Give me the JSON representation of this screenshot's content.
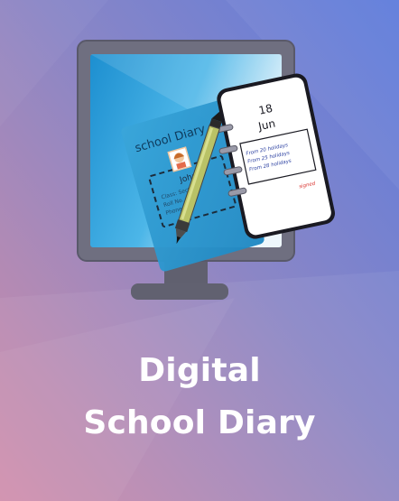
{
  "title": {
    "line1": "Digital",
    "line2": "School Diary"
  },
  "illustration": {
    "diary_cover_title": "school Diary",
    "student_name": "Johny",
    "id_card_lines": [
      "Class: Section",
      "Roll No.",
      "Phone No."
    ],
    "notebook_day": "18",
    "notebook_month": "Jun",
    "notebook_entries": [
      "From 20 holidays",
      "From 25 holidays",
      "From 28 holidays"
    ],
    "notebook_signature": "signed"
  },
  "colors": {
    "bg_top_right": "#5b78db",
    "bg_bottom_left": "#cf8aa8",
    "monitor_frame": "#6f6f80",
    "screen_blue": "#2da7de",
    "diary_cover": "#2b9bd0",
    "pen": "#b8c263",
    "text": "#ffffff"
  }
}
